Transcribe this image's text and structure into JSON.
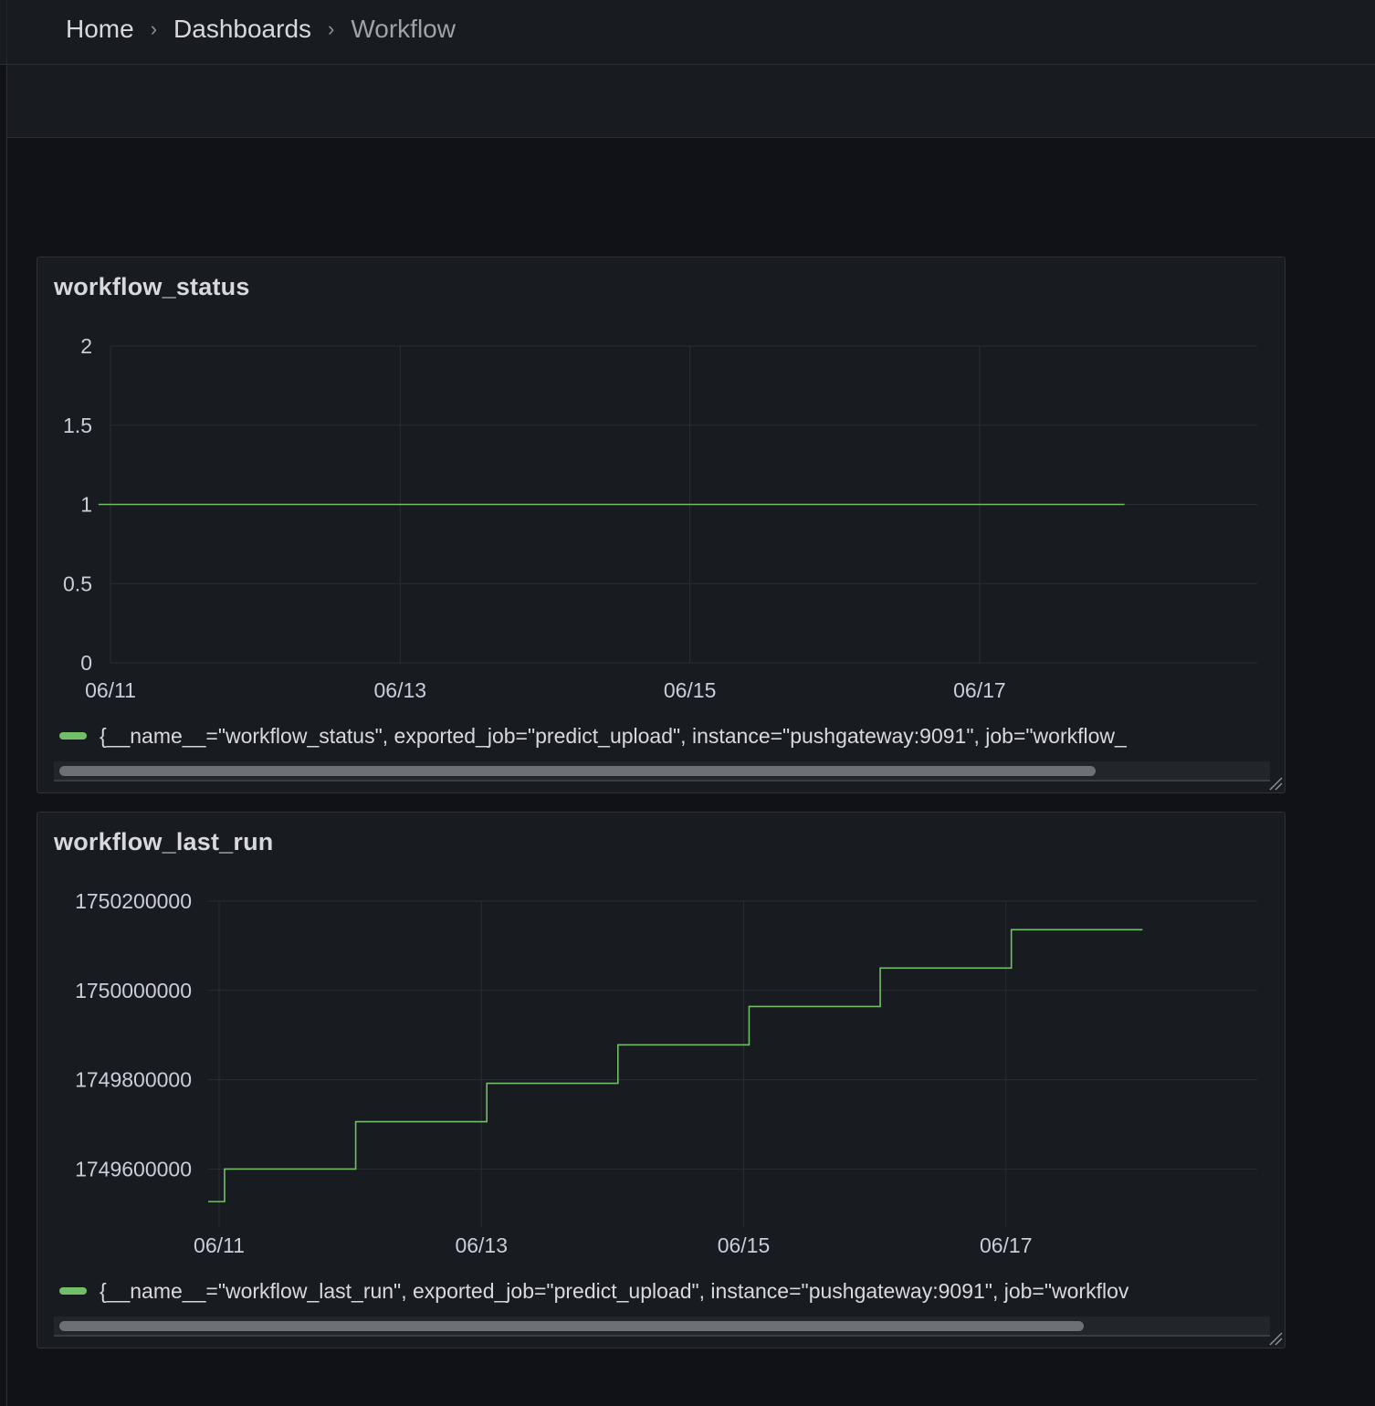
{
  "breadcrumb": {
    "home": "Home",
    "dashboards": "Dashboards",
    "current": "Workflow"
  },
  "colors": {
    "series": "#73bf69",
    "grid": "#2a2d33",
    "panel_bg": "#181b1f",
    "page_bg": "#111217"
  },
  "panels": [
    {
      "title": "workflow_status",
      "legend": "{__name__=\"workflow_status\", exported_job=\"predict_upload\", instance=\"pushgateway:9091\", job=\"workflow_",
      "scroll_fraction": 0.86
    },
    {
      "title": "workflow_last_run",
      "legend": "{__name__=\"workflow_last_run\", exported_job=\"predict_upload\", instance=\"pushgateway:9091\", job=\"workflov",
      "scroll_fraction": 0.85
    }
  ],
  "chart_data": [
    {
      "type": "line",
      "title": "workflow_status",
      "xlabel": "",
      "ylabel": "",
      "x_ticks": [
        "06/11",
        "06/13",
        "06/15",
        "06/17"
      ],
      "y_ticks": [
        "0",
        "0.5",
        "1",
        "1.5",
        "2"
      ],
      "ylim": [
        0,
        2
      ],
      "xlim": [
        "06/11 00:00",
        "06/18 22:00"
      ],
      "grid": true,
      "legend_placement": "bottom",
      "series": [
        {
          "x": [
            "06/10 22:00",
            "06/18 00:00"
          ],
          "values": [
            1,
            1
          ]
        }
      ]
    },
    {
      "type": "line",
      "title": "workflow_last_run",
      "xlabel": "",
      "ylabel": "",
      "x_ticks": [
        "06/11",
        "06/13",
        "06/15",
        "06/17"
      ],
      "y_ticks": [
        "1749600000",
        "1749800000",
        "1750000000",
        "1750200000"
      ],
      "ylim": [
        1749470000,
        1750200000
      ],
      "xlim": [
        "06/10 22:00",
        "06/18 22:00"
      ],
      "grid": true,
      "legend_placement": "bottom",
      "step": true,
      "series": [
        {
          "x": [
            "06/10 22:00",
            "06/11 01:00",
            "06/12 01:00",
            "06/13 01:00",
            "06/14 01:00",
            "06/15 01:00",
            "06/16 01:00",
            "06/17 01:00",
            "06/18 01:00"
          ],
          "values": [
            1749527000,
            1749600000,
            1749706000,
            1749792000,
            1749878000,
            1749964000,
            1750050000,
            1750136000,
            1750136000
          ]
        }
      ]
    }
  ]
}
